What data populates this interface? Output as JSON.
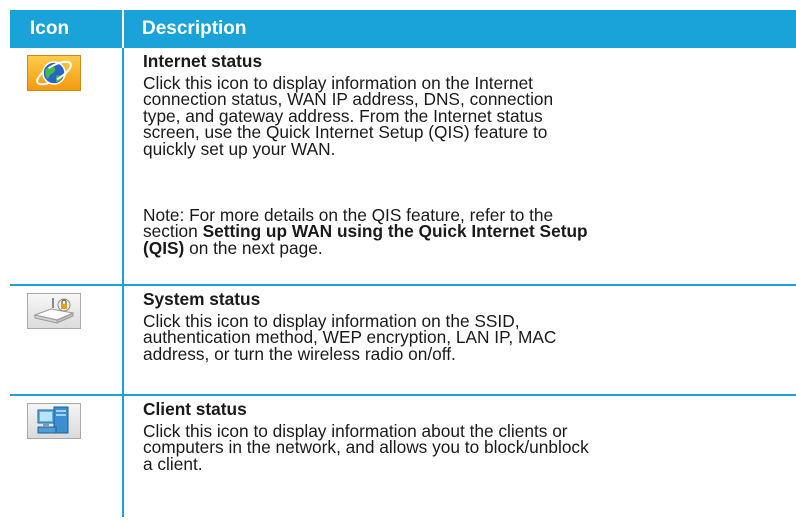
{
  "header": {
    "col_icon": "Icon",
    "col_desc": "Description"
  },
  "rows": [
    {
      "icon": "globe-icon",
      "title": "Internet status",
      "body": [
        "Click this icon to display information on the Internet",
        "connection status, WAN IP address,  DNS, connection",
        "type, and gateway address.  From the Internet status",
        "screen, use the Quick Internet Setup (QIS) feature to",
        "quickly set up your WAN."
      ],
      "note": {
        "line1": "Note: For more details on the QIS feature, refer to the",
        "line2_pre": "section ",
        "line2_bold": "Setting up WAN using the Quick Internet Setup",
        "line3_bold": "(QIS)",
        "line3_post": " on the next page."
      }
    },
    {
      "icon": "router-lock-icon",
      "title": "System status",
      "body": [
        "Click this icon to display information on the SSID,",
        "authentication method, WEP encryption, LAN IP, MAC",
        "address, or turn the wireless radio on/off."
      ]
    },
    {
      "icon": "computers-icon",
      "title": "Client status",
      "body": [
        "Click this icon to display information about the clients or",
        "computers in the network, and allows you to block/unblock",
        "a client."
      ]
    }
  ]
}
